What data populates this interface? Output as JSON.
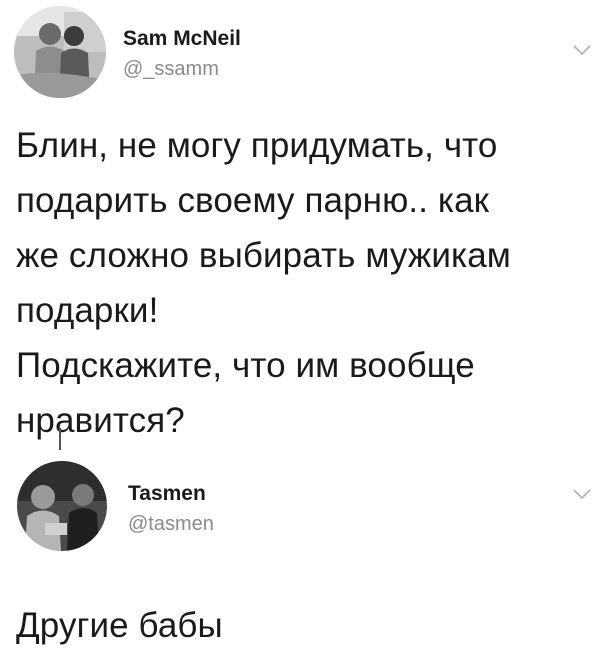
{
  "tweets": [
    {
      "author": {
        "display_name": "Sam McNeil",
        "handle": "@_ssamm",
        "avatar_icon": "user-avatar-icon"
      },
      "text": "Блин, не могу придумать, что\nподарить своему парню.. как\nже сложно выбирать мужикам\nподарки!\nПодскажите, что им вообще\nнравится?",
      "menu_icon": "chevron-down-icon"
    },
    {
      "author": {
        "display_name": "Tasmen",
        "handle": "@tasmen",
        "avatar_icon": "user-avatar-icon"
      },
      "text": "Другие бабы",
      "menu_icon": "chevron-down-icon"
    }
  ],
  "colors": {
    "text": "#1a1a1a",
    "muted": "#8a8a8a",
    "background": "#ffffff"
  }
}
